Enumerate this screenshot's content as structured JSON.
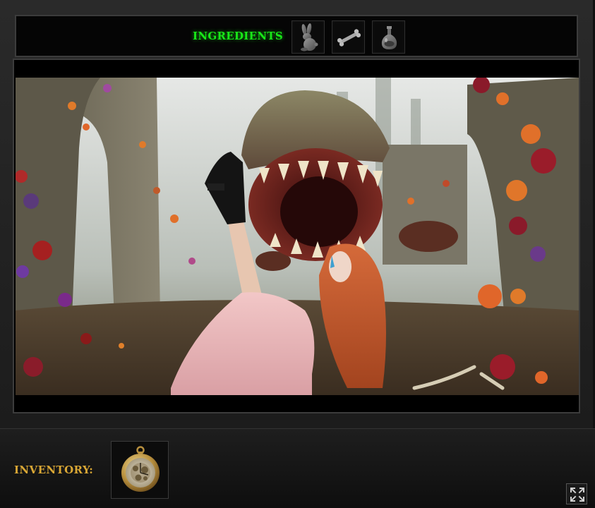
{
  "ingredients": {
    "title": "INGREDIENTS",
    "slots": [
      {
        "icon": "rabbit-icon"
      },
      {
        "icon": "bone-icon"
      },
      {
        "icon": "potion-bottle-icon"
      }
    ],
    "title_color": "#18e818"
  },
  "scene": {
    "name": "carnivorous-plant-garden-scene"
  },
  "inventory": {
    "label": "INVENTORY:",
    "label_color": "#d9a735",
    "items": [
      {
        "icon": "pocket-watch-icon"
      }
    ]
  },
  "controls": {
    "fullscreen_icon": "fullscreen-icon"
  }
}
